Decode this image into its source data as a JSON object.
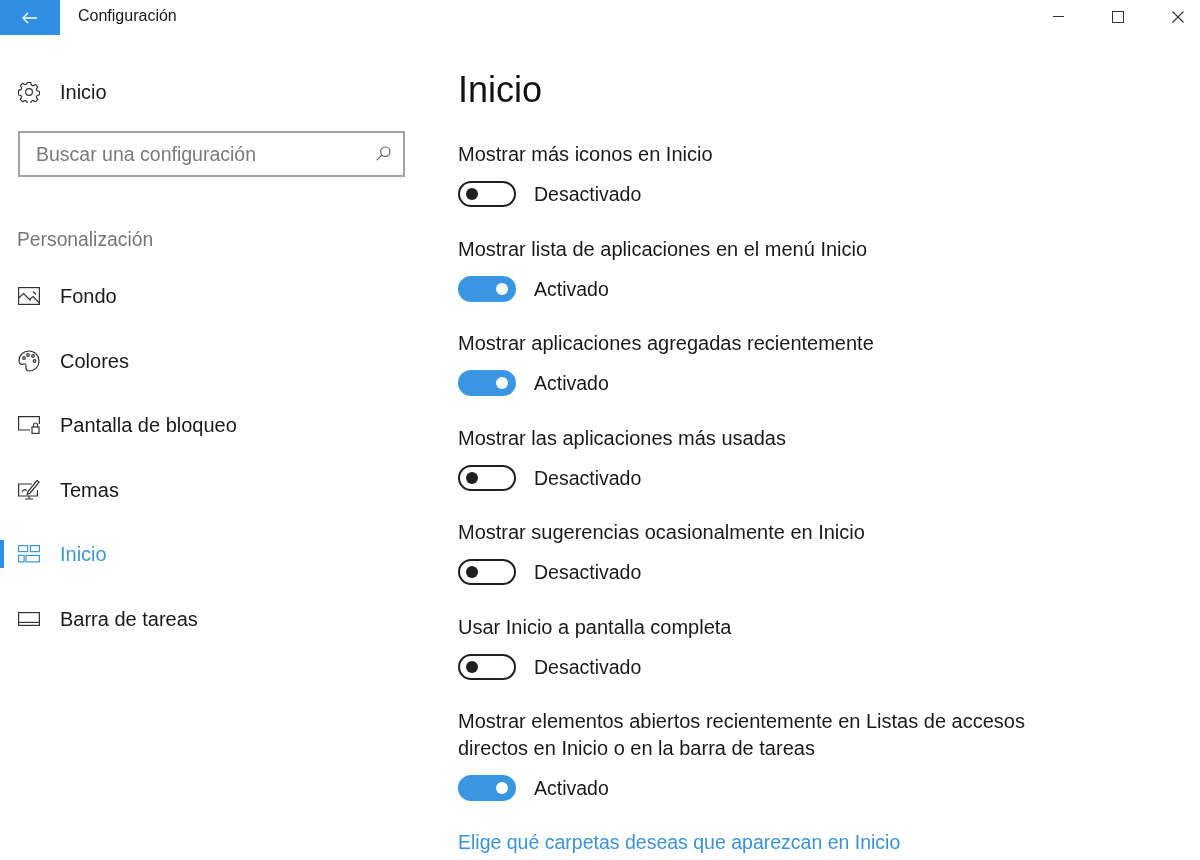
{
  "window": {
    "title": "Configuración"
  },
  "sidebar": {
    "home": "Inicio",
    "search": {
      "placeholder": "Buscar una configuración"
    },
    "section": "Personalización",
    "items": [
      {
        "label": "Fondo",
        "selected": false
      },
      {
        "label": "Colores",
        "selected": false
      },
      {
        "label": "Pantalla de bloqueo",
        "selected": false
      },
      {
        "label": "Temas",
        "selected": false
      },
      {
        "label": "Inicio",
        "selected": true
      },
      {
        "label": "Barra de tareas",
        "selected": false
      }
    ]
  },
  "main": {
    "heading": "Inicio",
    "settings": [
      {
        "label": "Mostrar más iconos en Inicio",
        "on": false,
        "state_text": "Desactivado"
      },
      {
        "label": "Mostrar lista de aplicaciones en el menú Inicio",
        "on": true,
        "state_text": "Activado"
      },
      {
        "label": "Mostrar aplicaciones agregadas recientemente",
        "on": true,
        "state_text": "Activado"
      },
      {
        "label": "Mostrar las aplicaciones más usadas",
        "on": false,
        "state_text": "Desactivado"
      },
      {
        "label": "Mostrar sugerencias ocasionalmente en Inicio",
        "on": false,
        "state_text": "Desactivado"
      },
      {
        "label": "Usar Inicio a pantalla completa",
        "on": false,
        "state_text": "Desactivado"
      },
      {
        "label": "Mostrar elementos abiertos recientemente en Listas de accesos directos en Inicio o en la barra de tareas",
        "on": true,
        "state_text": "Activado"
      }
    ],
    "link": "Elige qué carpetas deseas que aparezcan en Inicio"
  }
}
